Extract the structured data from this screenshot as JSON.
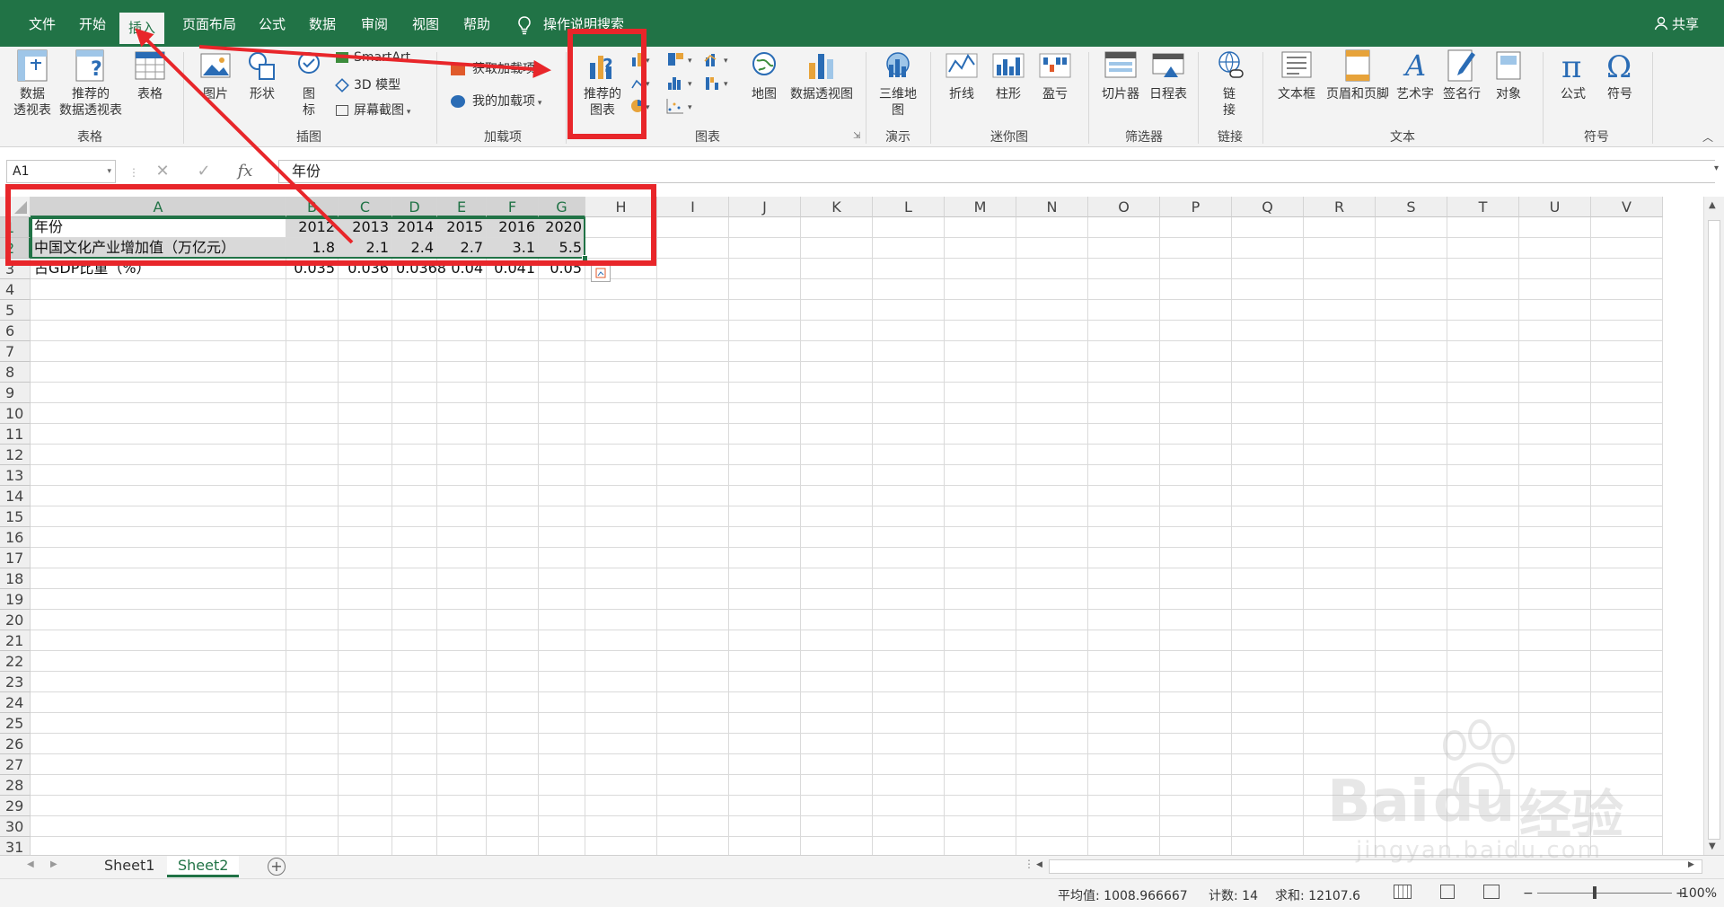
{
  "tabs": [
    {
      "label": "文件"
    },
    {
      "label": "开始"
    },
    {
      "label": "插入",
      "active": true
    },
    {
      "label": "页面布局"
    },
    {
      "label": "公式"
    },
    {
      "label": "数据"
    },
    {
      "label": "审阅"
    },
    {
      "label": "视图"
    },
    {
      "label": "帮助"
    }
  ],
  "tell_me": "操作说明搜索",
  "share": "共享",
  "ribbon": {
    "tables": {
      "pivot": "数据\n透视表",
      "recommended_pivot": "推荐的\n数据透视表",
      "table": "表格",
      "group": "表格"
    },
    "illustrations": {
      "pictures": "图片",
      "shapes": "形状",
      "icons": "图\n标",
      "smartart": "SmartArt",
      "model3d": "3D 模型",
      "screenshot": "屏幕截图",
      "group": "插图"
    },
    "addins": {
      "get": "获取加载项",
      "my": "我的加载项",
      "group": "加载项"
    },
    "charts": {
      "recommended": "推荐的\n图表",
      "maps": "地图",
      "pivotchart": "数据透视图",
      "group": "图表"
    },
    "tours": {
      "map3d": "三维地\n图",
      "group": "演示"
    },
    "sparklines": {
      "line": "折线",
      "column": "柱形",
      "winloss": "盈亏",
      "group": "迷你图"
    },
    "filters": {
      "slicer": "切片器",
      "timeline": "日程表",
      "group": "筛选器"
    },
    "links": {
      "link": "链\n接",
      "group": "链接"
    },
    "text": {
      "textbox": "文本框",
      "headerfooter": "页眉和页脚",
      "wordart": "艺术字",
      "signature": "签名行",
      "object": "对象",
      "group": "文本"
    },
    "symbols": {
      "equation": "公式",
      "symbol": "符号",
      "group": "符号"
    }
  },
  "formula_bar": {
    "name_box": "A1",
    "value": "年份"
  },
  "columns": [
    "A",
    "B",
    "C",
    "D",
    "E",
    "F",
    "G",
    "H",
    "I",
    "J",
    "K",
    "L",
    "M",
    "N",
    "O",
    "P",
    "Q",
    "R",
    "S",
    "T",
    "U",
    "V"
  ],
  "rows": [
    "1",
    "2",
    "3",
    "4",
    "5",
    "6",
    "7",
    "8",
    "9",
    "10",
    "11",
    "12",
    "13",
    "14",
    "15",
    "16",
    "17",
    "18",
    "19",
    "20",
    "21",
    "22",
    "23",
    "24",
    "25",
    "26",
    "27",
    "28",
    "29",
    "30",
    "31"
  ],
  "cells": {
    "r1": [
      "年份",
      "2012",
      "2013",
      "2014",
      "2015",
      "2016",
      "2020"
    ],
    "r2": [
      "中国文化产业增加值（万亿元）",
      "1.8",
      "2.1",
      "2.4",
      "2.7",
      "3.1",
      "5.5"
    ],
    "r3": [
      "占GDP比重（%）",
      "0.035",
      "0.036",
      "0.0368",
      "0.04",
      "0.041",
      "0.05"
    ]
  },
  "sheets": [
    {
      "label": "Sheet1"
    },
    {
      "label": "Sheet2",
      "active": true
    }
  ],
  "status": {
    "average": "平均值: 1008.966667",
    "count": "计数: 14",
    "sum": "求和: 12107.6",
    "zoom": "100%"
  },
  "colors": {
    "excel_green": "#217346",
    "annotation_red": "#e8262a"
  },
  "watermark": {
    "brand": "Bai",
    "brand2": "du",
    "cn": "经验",
    "url": "jingyan.baidu.com"
  }
}
